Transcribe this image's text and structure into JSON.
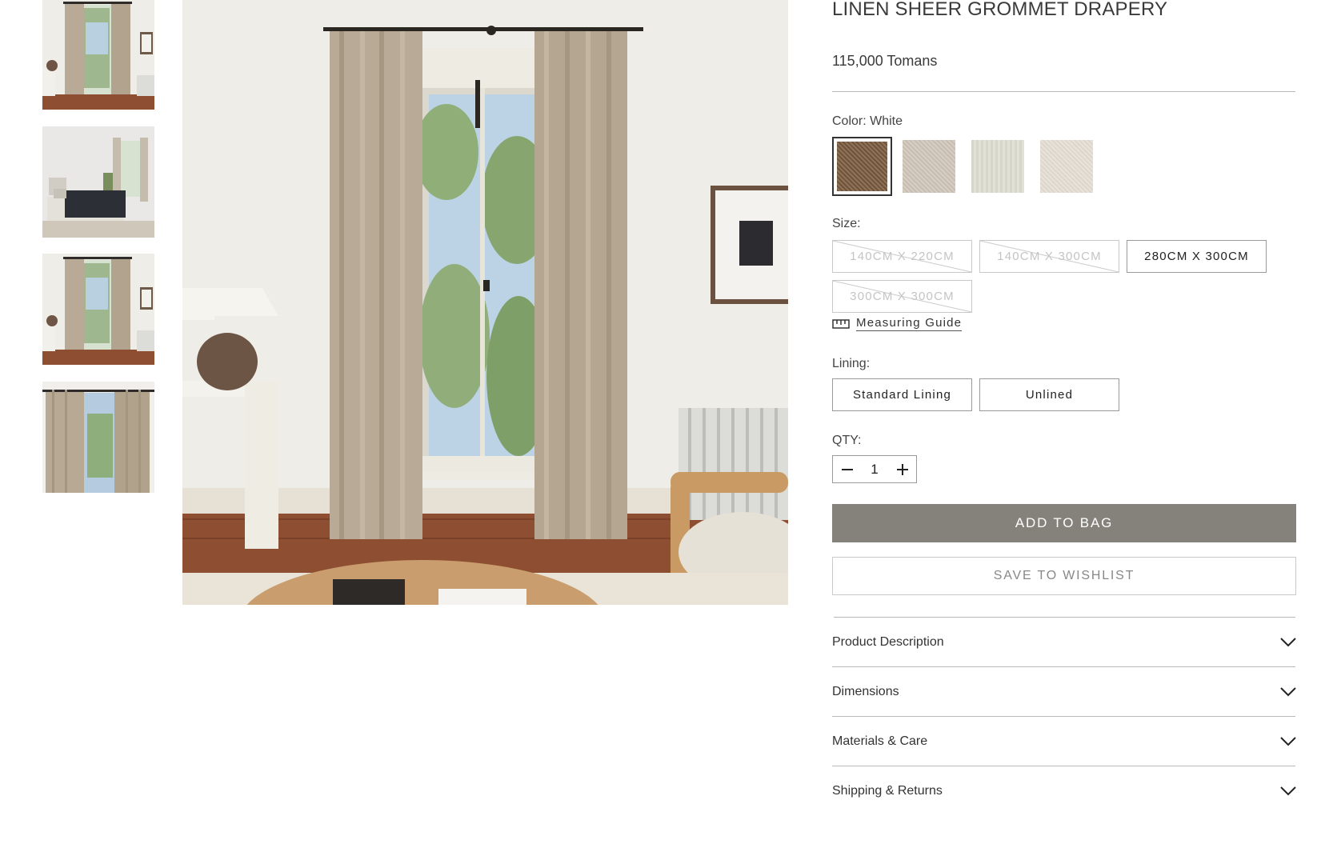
{
  "gallery": {
    "thumbnails": [
      {
        "name": "thumbnail-curtain-window"
      },
      {
        "name": "thumbnail-bedroom"
      },
      {
        "name": "thumbnail-curtain-window-2"
      },
      {
        "name": "thumbnail-curtain-closeup"
      }
    ]
  },
  "product": {
    "title": "LINEN SHEER GROMMET DRAPERY",
    "price": "115,000 Tomans",
    "color": {
      "label": "Color: White",
      "swatches": [
        {
          "name": "swatch-brown-weave",
          "color": "#7d6247",
          "selected": true
        },
        {
          "name": "swatch-natural-linen",
          "color": "#cfc6bb"
        },
        {
          "name": "swatch-ivory",
          "color": "#dddcd2"
        },
        {
          "name": "swatch-oatmeal",
          "color": "#e2ddd3"
        }
      ]
    },
    "size": {
      "label": "Size:",
      "options": [
        {
          "label": "140CM X 220CM",
          "available": false
        },
        {
          "label": "140CM X 300CM",
          "available": false
        },
        {
          "label": "280CM X 300CM",
          "available": true
        },
        {
          "label": "300CM X 300CM",
          "available": false
        }
      ],
      "guide_label": "Measuring Guide",
      "guide_icon": "ruler-icon"
    },
    "lining": {
      "label": "Lining:",
      "options": [
        "Standard Lining",
        "Unlined"
      ]
    },
    "qty": {
      "label": "QTY:",
      "value": "1",
      "decrement_icon": "minus-icon",
      "increment_icon": "plus-icon"
    },
    "add_to_bag_label": "ADD TO BAG",
    "save_to_wishlist_label": "SAVE TO WISHLIST",
    "accordion": [
      {
        "label": "Product Description",
        "icon": "chevron-down-icon"
      },
      {
        "label": "Dimensions",
        "icon": "chevron-down-icon"
      },
      {
        "label": "Materials & Care",
        "icon": "chevron-down-icon"
      },
      {
        "label": "Shipping & Returns",
        "icon": "chevron-down-icon"
      }
    ]
  },
  "colors": {
    "add_button": "#85827c",
    "wall": "#efede7",
    "curtain": "#b8aa96",
    "floor": "#8e4e32"
  }
}
